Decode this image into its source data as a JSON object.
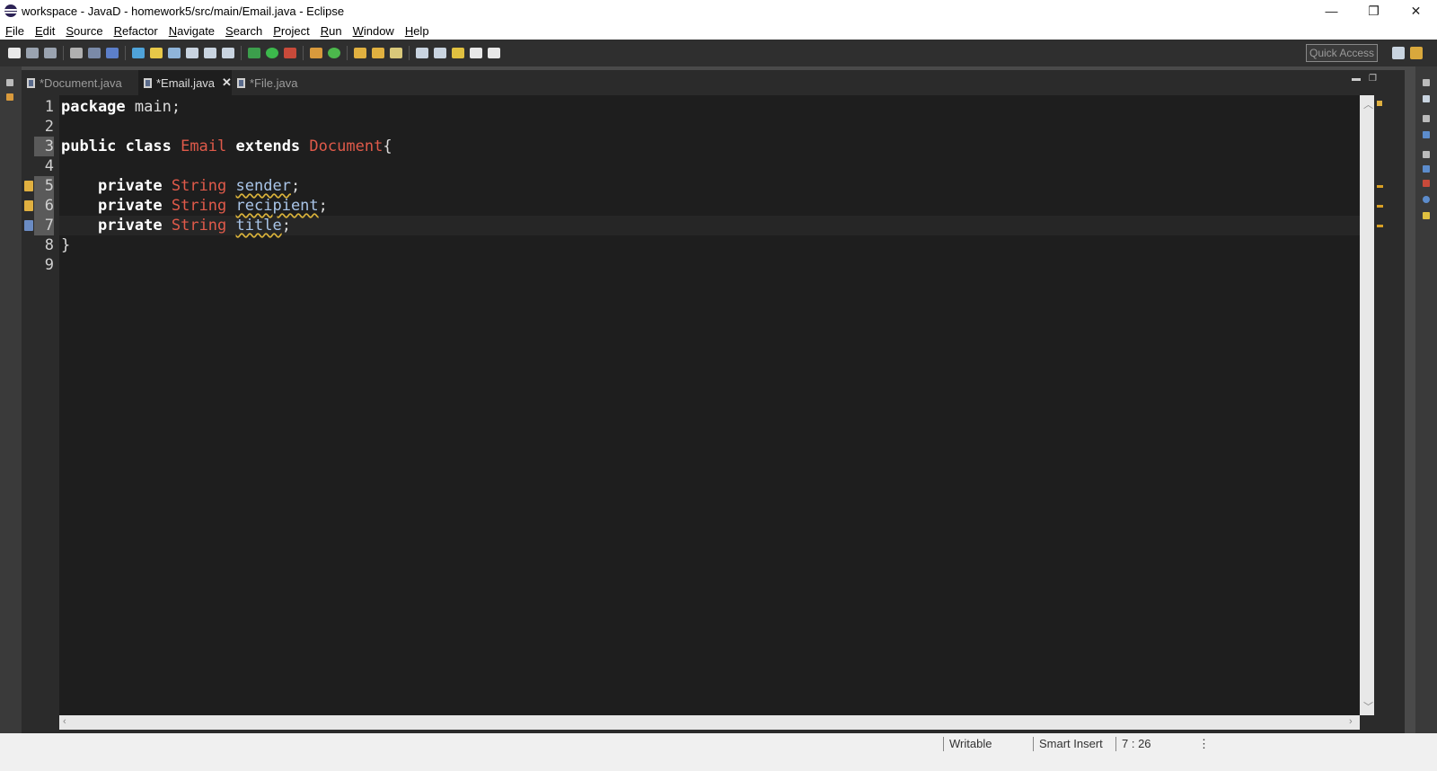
{
  "window": {
    "title": "workspace - JavaD - homework5/src/main/Email.java - Eclipse",
    "minimize_glyph": "—",
    "restore_glyph": "❐",
    "close_glyph": "✕"
  },
  "menu": [
    "File",
    "Edit",
    "Source",
    "Refactor",
    "Navigate",
    "Search",
    "Project",
    "Run",
    "Window",
    "Help"
  ],
  "toolbar": {
    "quick_access": "Quick Access"
  },
  "tabs": [
    {
      "label": "*Document.java",
      "active": false
    },
    {
      "label": "*Email.java",
      "active": true
    },
    {
      "label": "*File.java",
      "active": false
    }
  ],
  "editor": {
    "line_numbers": [
      "1",
      "2",
      "3",
      "4",
      "5",
      "6",
      "7",
      "8",
      "9"
    ],
    "lines": {
      "l1": {
        "kw": "package",
        "rest": " main;"
      },
      "l3": {
        "kw1": "public class",
        "name": "Email",
        "kw2": "extends",
        "parent": "Document",
        "tail": "{"
      },
      "l5": {
        "kw": "private",
        "type": "String",
        "field": "sender",
        "tail": ";"
      },
      "l6": {
        "kw": "private",
        "type": "String",
        "field": "recipient",
        "tail": ";"
      },
      "l7": {
        "kw": "private",
        "type": "String",
        "field": "title",
        "tail": ";"
      },
      "l8": {
        "text": "}"
      }
    },
    "current_line": 7
  },
  "status": {
    "writable": "Writable",
    "insert_mode": "Smart Insert",
    "position": "7 : 26"
  },
  "colors": {
    "keyword": "#ffffff",
    "type": "#e05a4a",
    "field": "#a9c5e8",
    "background": "#1e1e1e",
    "warning": "#e0b040"
  }
}
